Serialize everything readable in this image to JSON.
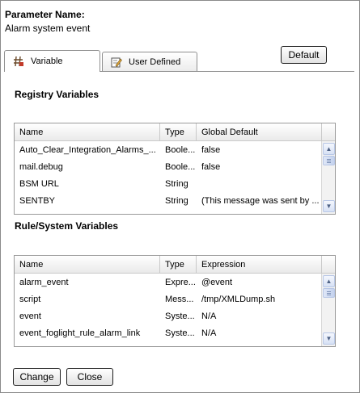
{
  "header": {
    "title": "Parameter Name:",
    "value": "Alarm system event"
  },
  "tabs": [
    {
      "label": "Variable",
      "icon": "variable-icon",
      "active": true
    },
    {
      "label": "User Defined",
      "icon": "edit-icon",
      "active": false
    }
  ],
  "default_button": "Default",
  "registry": {
    "title": "Registry Variables",
    "columns": [
      "Name",
      "Type",
      "Global Default"
    ],
    "rows": [
      [
        "Auto_Clear_Integration_Alarms_...",
        "Boole...",
        "false"
      ],
      [
        "mail.debug",
        "Boole...",
        "false"
      ],
      [
        "BSM URL",
        "String",
        ""
      ],
      [
        "SENTBY",
        "String",
        "(This message was sent by ..."
      ]
    ]
  },
  "rule_system": {
    "title": "Rule/System Variables",
    "columns": [
      "Name",
      "Type",
      "Expression"
    ],
    "rows": [
      [
        "alarm_event",
        "Expre...",
        "@event"
      ],
      [
        "script",
        "Mess...",
        "/tmp/XMLDump.sh"
      ],
      [
        "event",
        "Syste...",
        "N/A"
      ],
      [
        "event_foglight_rule_alarm_link",
        "Syste...",
        "N/A"
      ]
    ]
  },
  "buttons": {
    "change": "Change",
    "close": "Close"
  },
  "scroll_arrows": {
    "up": "▲",
    "down": "▼"
  }
}
